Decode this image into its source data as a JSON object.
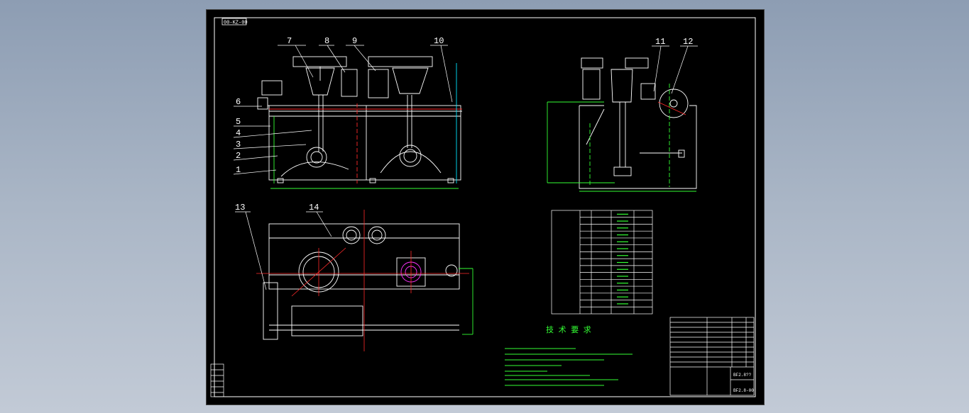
{
  "drawing": {
    "corner_label": "00-KZ-00",
    "part_labels": [
      "7",
      "8",
      "9",
      "10",
      "11",
      "12",
      "6",
      "5",
      "4",
      "3",
      "2",
      "1",
      "13",
      "14"
    ],
    "title": "技 术 要 求",
    "table_rows": 15,
    "title_block": {
      "drawing_no": "BF2.8??",
      "code": "BF2.8-00"
    }
  },
  "colors": {
    "line": "#ffffff",
    "green": "#33ff33",
    "red": "#ff2a2a",
    "cyan": "#00e5ff",
    "magenta": "#ff33ff",
    "yellow": "#ffff33",
    "background": "#000000"
  }
}
